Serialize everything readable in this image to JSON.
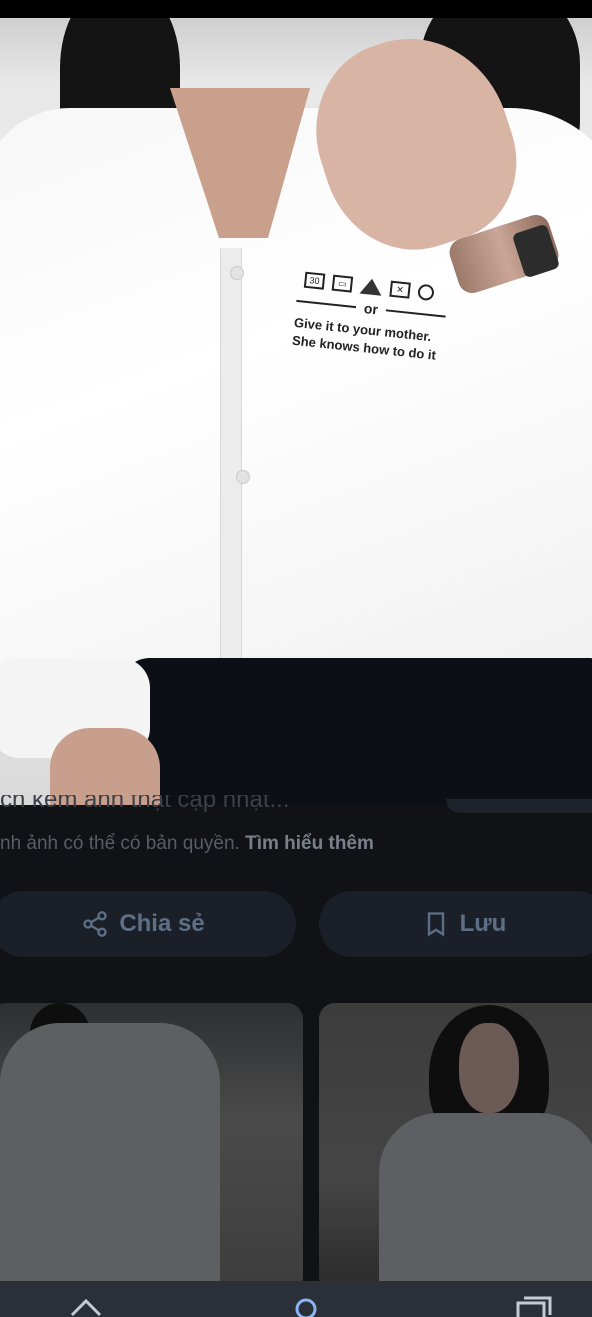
{
  "photo": {
    "print_line_or": "or",
    "print_line_1": "Give it to your mother.",
    "print_line_2": "She knows how to do it",
    "care_label_temp": "30"
  },
  "details": {
    "title_partial": "ch kèm ảnh thật cập nhật...",
    "copyright_text": "nh ảnh có thể có bản quyền.",
    "learn_more": "Tìm hiểu thêm"
  },
  "actions": {
    "share_label": "Chia sẻ",
    "save_label": "Lưu"
  },
  "bottom_nav": {
    "icons": [
      "home-icon",
      "search-icon",
      "tabs-icon"
    ]
  },
  "colors": {
    "background": "#101216",
    "button_bg": "#1b2028",
    "button_text": "#5c6f86",
    "nav_bg": "#2a2f38"
  }
}
